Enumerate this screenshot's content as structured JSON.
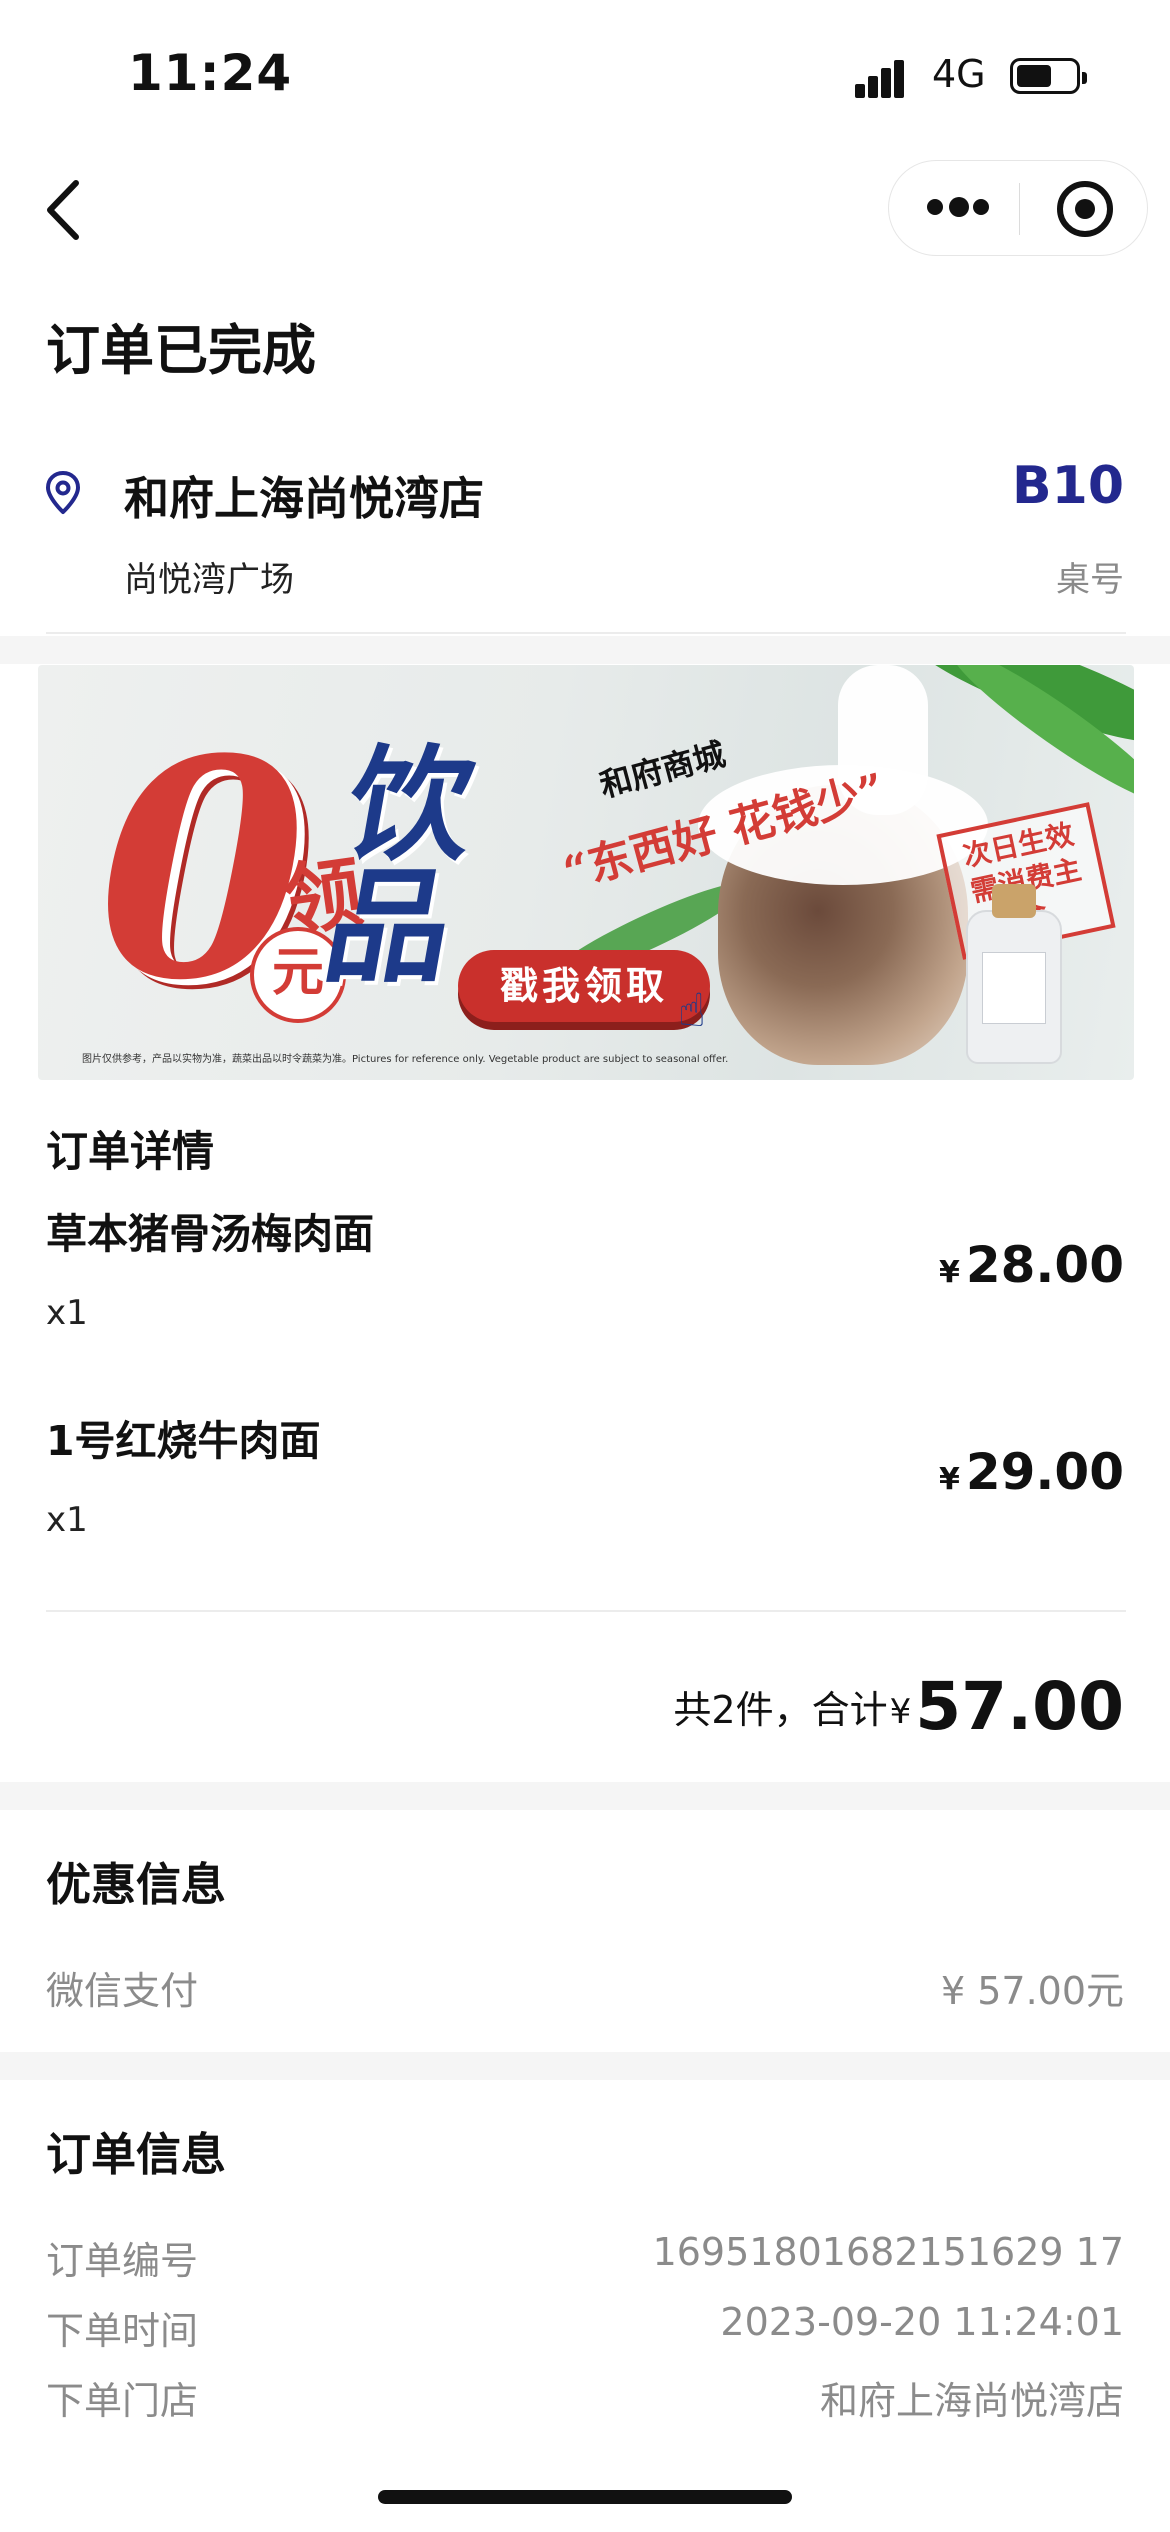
{
  "status_bar": {
    "time": "11:24",
    "network": "4G"
  },
  "header": {
    "title": "订单已完成"
  },
  "store": {
    "name": "和府上海尚悦湾店",
    "area": "尚悦湾广场",
    "table_number": "B10",
    "table_label": "桌号"
  },
  "banner": {
    "big_digit": "0",
    "ling": "领",
    "yuan": "元",
    "drinks": "饮品",
    "mall": "和府商城",
    "slogan": "“东西好 花钱少”",
    "cta": "戳我领取",
    "stamp": "次日生效需消费主食",
    "disclaimer": "图片仅供参考，产品以实物为准，蔬菜出品以时令蔬菜为准。Pictures for reference only. Vegetable product are subject to seasonal offer."
  },
  "order_details": {
    "title": "订单详情",
    "items": [
      {
        "name": "草本猪骨汤梅肉面",
        "qty": "x1",
        "currency": "¥",
        "price": "28.00"
      },
      {
        "name": "1号红烧牛肉面",
        "qty": "x1",
        "currency": "¥",
        "price": "29.00"
      }
    ],
    "summary_prefix": "共2件，合计",
    "currency": "¥",
    "total": "57.00"
  },
  "discount": {
    "title": "优惠信息",
    "label": "微信支付",
    "value": "¥ 57.00元"
  },
  "order_info": {
    "title": "订单信息",
    "rows": [
      {
        "label": "订单编号",
        "value": "16951801682151629 17"
      },
      {
        "label": "下单时间",
        "value": "2023-09-20 11:24:01"
      },
      {
        "label": "下单门店",
        "value": "和府上海尚悦湾店"
      }
    ]
  },
  "icons": [
    "back-chevron-icon",
    "more-icon",
    "target-icon",
    "location-pin-icon",
    "signal-icon",
    "battery-icon",
    "hand-cursor-icon"
  ],
  "colors": {
    "accent_blue": "#23288e",
    "banner_red": "#d33c36",
    "label_gray": "#8b8b8b"
  }
}
